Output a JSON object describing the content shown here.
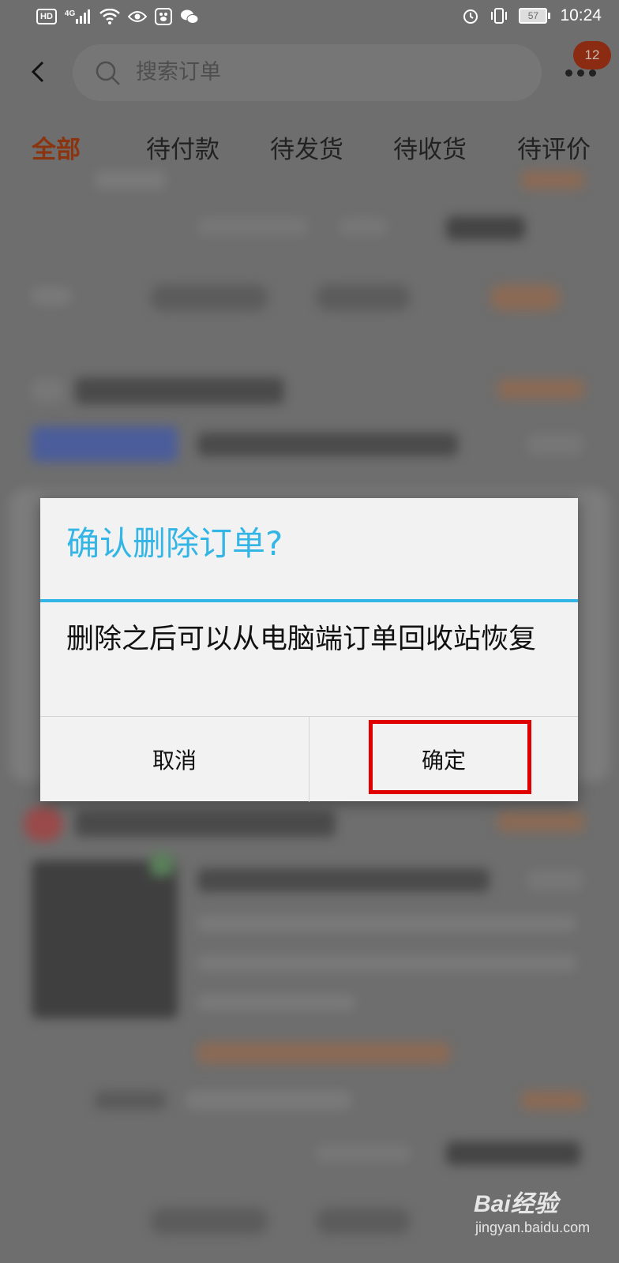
{
  "status_bar": {
    "hd": "HD",
    "network": "4G",
    "battery": "57",
    "time": "10:24"
  },
  "header": {
    "search_placeholder": "搜索订单",
    "notification_count": "12"
  },
  "tabs": [
    {
      "label": "全部",
      "active": true
    },
    {
      "label": "待付款",
      "active": false
    },
    {
      "label": "待发货",
      "active": false
    },
    {
      "label": "待收货",
      "active": false
    },
    {
      "label": "待评价",
      "active": false
    }
  ],
  "dialog": {
    "title": "确认删除订单?",
    "message": "删除之后可以从电脑端订单回收站恢复",
    "cancel_label": "取消",
    "confirm_label": "确定"
  },
  "watermark": {
    "main": "Bai经验",
    "sub": "jingyan.baidu.com"
  },
  "colors": {
    "accent": "#33b5e5",
    "highlight": "#e00000",
    "active_tab": "#8a3410"
  }
}
